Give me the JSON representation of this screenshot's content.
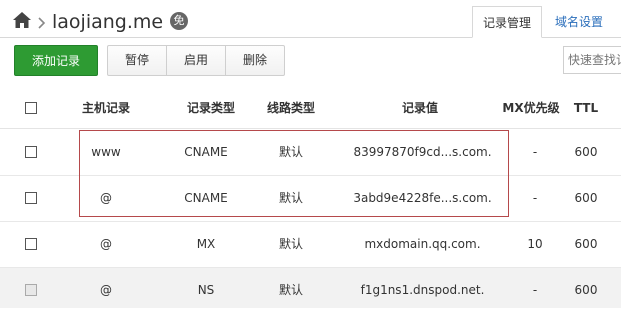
{
  "header": {
    "domain": "laojiang.me",
    "free_badge": "免",
    "home_icon": "home-icon",
    "chevron_icon": "chevron-right-icon"
  },
  "tabs": [
    {
      "label": "记录管理",
      "active": true
    },
    {
      "label": "域名设置",
      "active": false
    }
  ],
  "toolbar": {
    "add_label": "添加记录",
    "pause_label": "暂停",
    "enable_label": "启用",
    "delete_label": "删除",
    "search_placeholder": "快速查找记录"
  },
  "colors": {
    "accent_green": "#2e9b33",
    "link_blue": "#2a6ebb",
    "highlight_border": "#b5494b"
  },
  "table": {
    "headers": {
      "host": "主机记录",
      "type": "记录类型",
      "line": "线路类型",
      "value": "记录值",
      "mx": "MX优先级",
      "ttl": "TTL"
    },
    "rows": [
      {
        "host": "www",
        "type": "CNAME",
        "line": "默认",
        "value": "83997870f9cd...s.com.",
        "mx": "-",
        "ttl": "600",
        "enabled": true
      },
      {
        "host": "@",
        "type": "CNAME",
        "line": "默认",
        "value": "3abd9e4228fe...s.com.",
        "mx": "-",
        "ttl": "600",
        "enabled": true
      },
      {
        "host": "@",
        "type": "MX",
        "line": "默认",
        "value": "mxdomain.qq.com.",
        "mx": "10",
        "ttl": "600",
        "enabled": true
      },
      {
        "host": "@",
        "type": "NS",
        "line": "默认",
        "value": "f1g1ns1.dnspod.net.",
        "mx": "-",
        "ttl": "600",
        "enabled": false
      }
    ]
  }
}
